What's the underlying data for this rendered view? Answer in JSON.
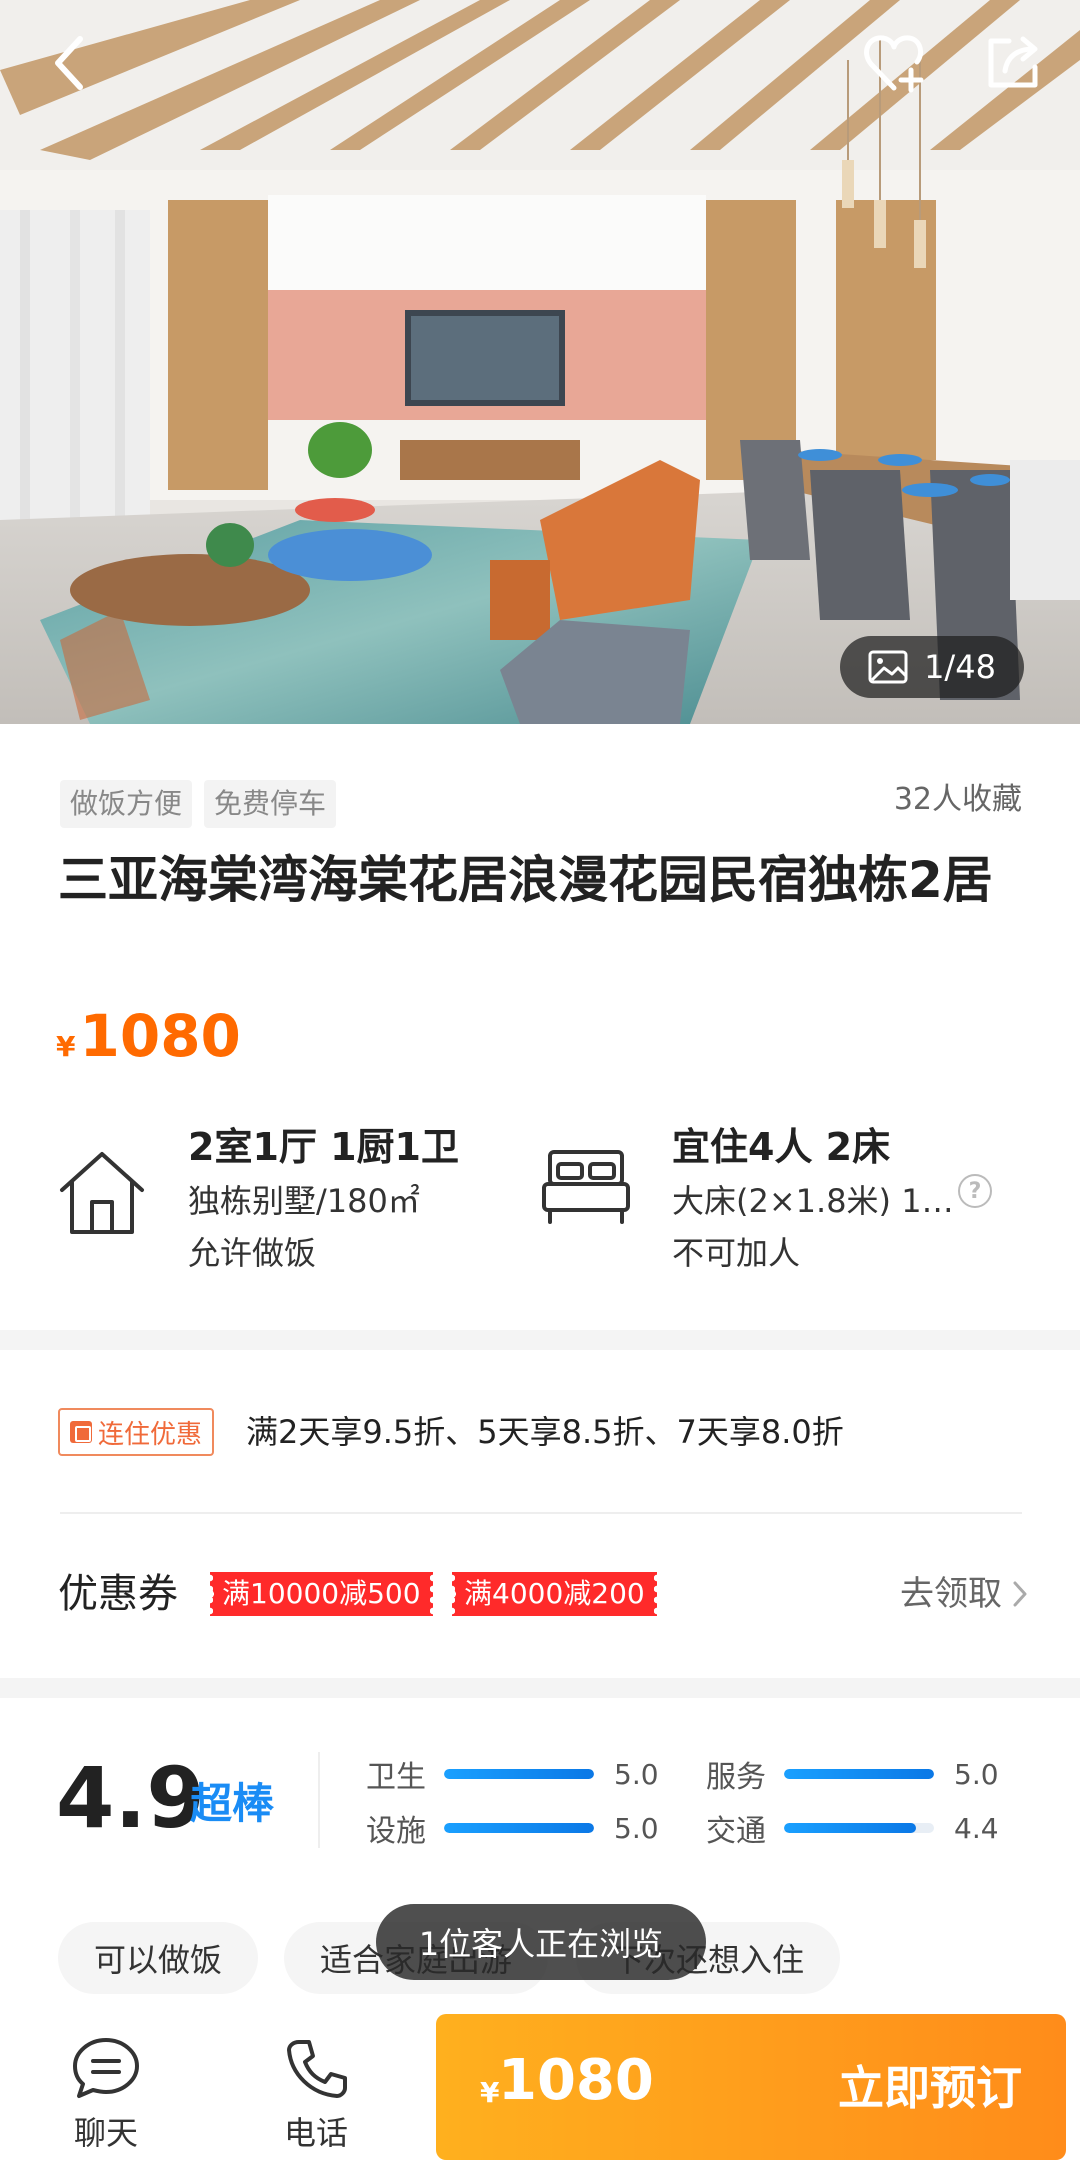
{
  "hero": {
    "photo_counter": "1/48",
    "icons": {
      "back": "back-arrow-icon",
      "favorite": "heart-plus-icon",
      "share": "share-icon",
      "gallery": "image-icon"
    }
  },
  "listing": {
    "tags": [
      "做饭方便",
      "免费停车"
    ],
    "favorites": "32人收藏",
    "title": "三亚海棠湾海棠花居浪漫花园民宿独栋2居",
    "price_symbol": "¥",
    "price": "1080"
  },
  "features": {
    "layout": {
      "title": "2室1厅 1厨1卫",
      "line2": "独栋别墅/180㎡",
      "line3": "允许做饭",
      "icon": "house-icon"
    },
    "beds": {
      "title": "宜住4人 2床",
      "line2": "大床(2×1.8米) 1…",
      "line3": "不可加人",
      "icon": "bed-icon",
      "help": "?"
    }
  },
  "promo": {
    "badge": "连住优惠",
    "text": "满2天享9.5折、5天享8.5折、7天享8.0折"
  },
  "coupons": {
    "label": "优惠券",
    "items": [
      "满10000减500",
      "满4000减200"
    ],
    "action": "去领取"
  },
  "rating": {
    "score": "4.9",
    "word": "超棒",
    "items": [
      {
        "label": "卫生",
        "value": "5.0",
        "fraction": 1.0
      },
      {
        "label": "设施",
        "value": "5.0",
        "fraction": 1.0
      },
      {
        "label": "服务",
        "value": "5.0",
        "fraction": 1.0
      },
      {
        "label": "交通",
        "value": "4.4",
        "fraction": 0.88
      }
    ]
  },
  "chips": [
    "可以做饭",
    "适合家庭出游",
    "下次还想入住"
  ],
  "toast": "1位客人正在浏览",
  "bottom_bar": {
    "chat_label": "聊天",
    "phone_label": "电话",
    "book_symbol": "¥",
    "book_price": "1080",
    "book_label": "立即预订"
  },
  "colors": {
    "accent": "#ff6a00",
    "blue": "#1a8cf5",
    "book_start": "#ffb01e",
    "book_end": "#ff8c1a",
    "coupon": "#ff2a2a"
  }
}
